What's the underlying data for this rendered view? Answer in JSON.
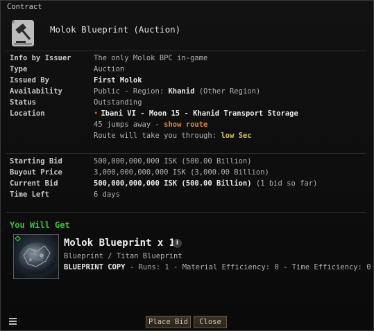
{
  "window": {
    "title": "Contract"
  },
  "header": {
    "contract_name": "Molok Blueprint (Auction)"
  },
  "details": {
    "info_by_issuer": {
      "label": "Info by Issuer",
      "value": "The only Molok BPC in-game"
    },
    "type": {
      "label": "Type",
      "value": "Auction"
    },
    "issued_by": {
      "label": "Issued By",
      "value": "First Molok"
    },
    "availability": {
      "label": "Availability",
      "prefix": "Public - Region: ",
      "region": "Khanid",
      "suffix": " (Other Region)"
    },
    "status": {
      "label": "Status",
      "value": "Outstanding"
    },
    "location": {
      "label": "Location",
      "value": "Ibani VI - Moon 15 - Khanid Transport Storage",
      "jumps_text": "45 jumps away - ",
      "show_route": "show route",
      "route_text": "Route will take you through: ",
      "route_security": "low Sec"
    }
  },
  "bids": {
    "starting_bid": {
      "label": "Starting Bid",
      "value": "500,000,000,000 ISK (500.00 Billion)"
    },
    "buyout_price": {
      "label": "Buyout Price",
      "value": "3,000,000,000,000 ISK (3,000.00 Billion)"
    },
    "current_bid": {
      "label": "Current Bid",
      "value": "500,000,000,000 ISK (500.00 Billion)",
      "note": " (1 bid so far)"
    },
    "time_left": {
      "label": "Time Left",
      "value": "6 days"
    }
  },
  "you_will_get": {
    "title": "You Will Get",
    "item_name": "Molok Blueprint x 1",
    "category": "Blueprint / Titan Blueprint",
    "copy_label": "BLUEPRINT COPY",
    "copy_details": " - Runs: 1 - Material Efficiency: 0 - Time Efficiency: 0",
    "info_glyph": "i"
  },
  "buttons": {
    "place_bid": "Place Bid",
    "close": "Close"
  },
  "colors": {
    "accent_green": "#39c236",
    "link_orange": "#e08a2c",
    "lowsec_yellow": "#d6c35a"
  }
}
